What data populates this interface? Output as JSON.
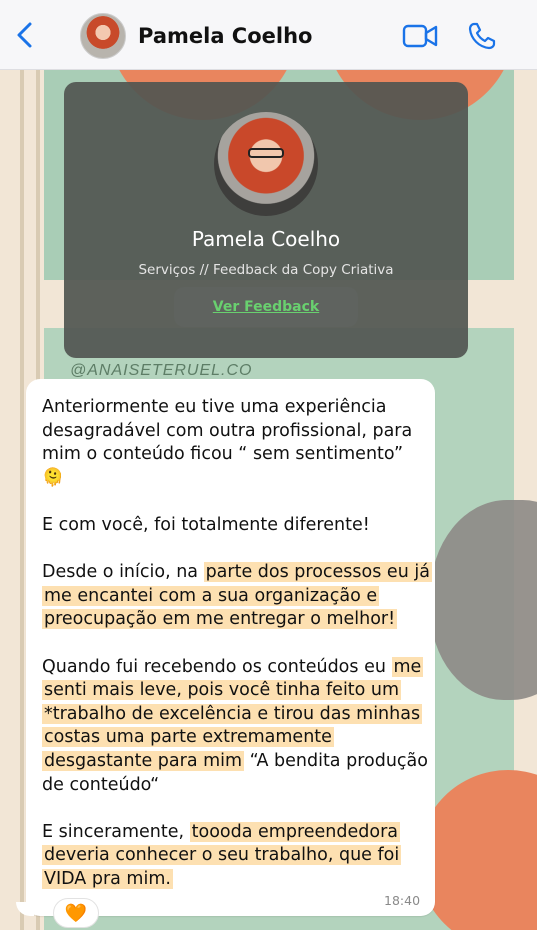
{
  "header": {
    "contact_name": "Pamela Coelho",
    "back_icon": "chevron-left-icon",
    "video_icon": "video-camera-icon",
    "call_icon": "phone-icon",
    "accent_color": "#1a73e8"
  },
  "card": {
    "name": "Pamela Coelho",
    "subtitle": "Serviços // Feedback da Copy Criativa",
    "button_label": "Ver Feedback",
    "button_color": "#69d06f"
  },
  "wallpaper": {
    "watermark": "@ANAISETERUEL.CO"
  },
  "message": {
    "paragraphs": [
      [
        {
          "text": "Anteriormente eu tive uma experiência desagradável com outra profissional, para mim o conteúdo ficou “ sem sentimento” 🫠",
          "hl": false
        }
      ],
      [
        {
          "text": "E com você, foi totalmente diferente!",
          "hl": false
        }
      ],
      [
        {
          "text": "Desde o início, na ",
          "hl": false
        },
        {
          "text": "parte dos processos eu já me encantei com a sua organização e preocupação em me entregar o melhor!",
          "hl": true
        }
      ],
      [
        {
          "text": "Quando fui recebendo os conteúdos eu ",
          "hl": false
        },
        {
          "text": "me senti mais leve, pois você tinha feito um *trabalho de excelência e tirou das minhas costas uma parte extremamente desgastante para mim",
          "hl": true
        },
        {
          "text": " “A bendita produção de conteúdo“",
          "hl": false
        }
      ],
      [
        {
          "text": "E sinceramente, ",
          "hl": false
        },
        {
          "text": "toooda empreendedora deveria conhecer o seu trabalho, que foi VIDA pra mim.",
          "hl": true
        }
      ]
    ],
    "timestamp": "18:40",
    "reaction": "🧡",
    "highlight_color": "#fde0b1"
  }
}
